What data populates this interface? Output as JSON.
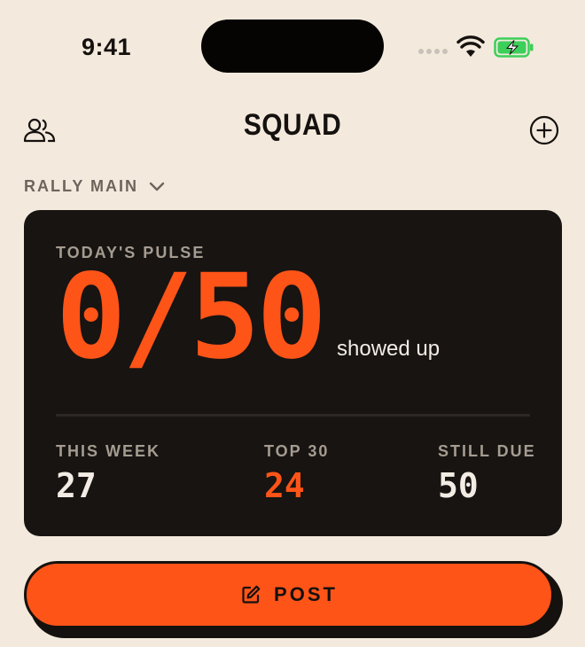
{
  "status_bar": {
    "time": "9:41"
  },
  "header": {
    "title": "SQUAD"
  },
  "selector": {
    "label": "RALLY MAIN"
  },
  "pulse": {
    "eyebrow": "TODAY'S PULSE",
    "value": "0/50",
    "unit": "showed up"
  },
  "stats": [
    {
      "label": "THIS WEEK",
      "value": "27"
    },
    {
      "label": "TOP 30",
      "value": "24"
    },
    {
      "label": "STILL DUE",
      "value": "50"
    }
  ],
  "post_button": {
    "label": "POST"
  },
  "colors": {
    "accent": "#ff5418",
    "background": "#f3eadd",
    "card": "#171412",
    "ink": "#15110e",
    "battery": "#3ccf5a"
  },
  "icons": [
    "people-icon",
    "plus-circle-icon",
    "chevron-down-icon",
    "edit-icon",
    "wifi-icon",
    "battery-charging-icon"
  ]
}
